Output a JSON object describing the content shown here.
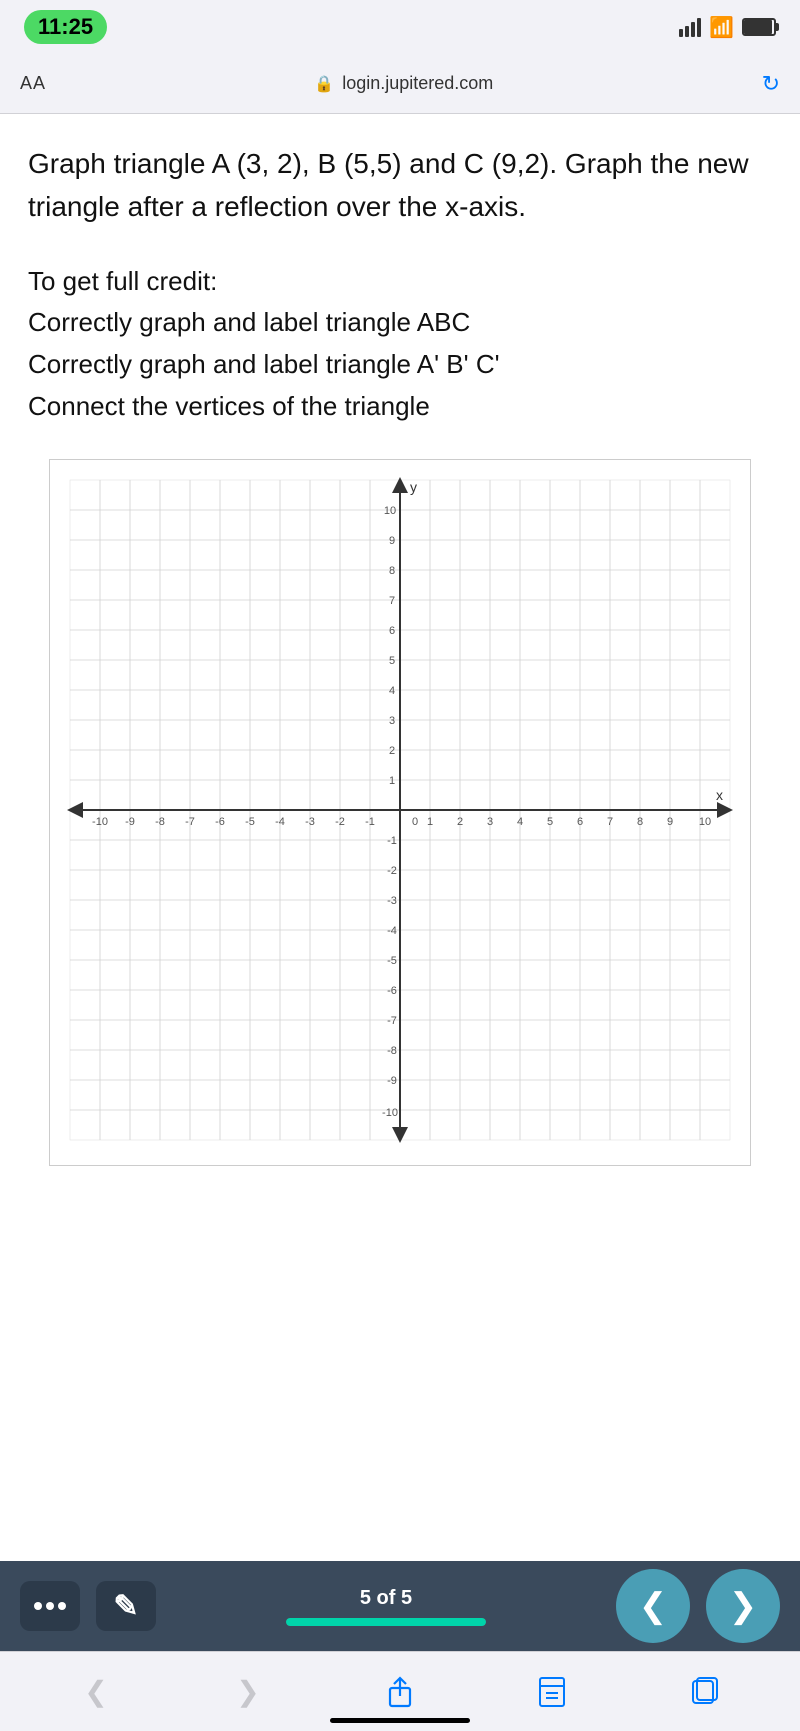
{
  "statusBar": {
    "time": "11:25"
  },
  "addressBar": {
    "url": "login.jupitered.com",
    "aaLabel": "AA"
  },
  "content": {
    "problemText": "Graph triangle A (3, 2), B (5,5) and C (9,2). Graph the new triangle after a reflection over the x-axis.",
    "creditTitle": "To get full credit:",
    "creditLine1": "Correctly graph and label triangle ABC",
    "creditLine2": "Correctly graph and label triangle A' B' C'",
    "creditLine3": "Connect the vertices of the triangle"
  },
  "bottomNav": {
    "pageLabel": "5 of 5",
    "progressPercent": 100
  },
  "iosBar": {
    "backLabel": "<",
    "forwardLabel": ">"
  }
}
